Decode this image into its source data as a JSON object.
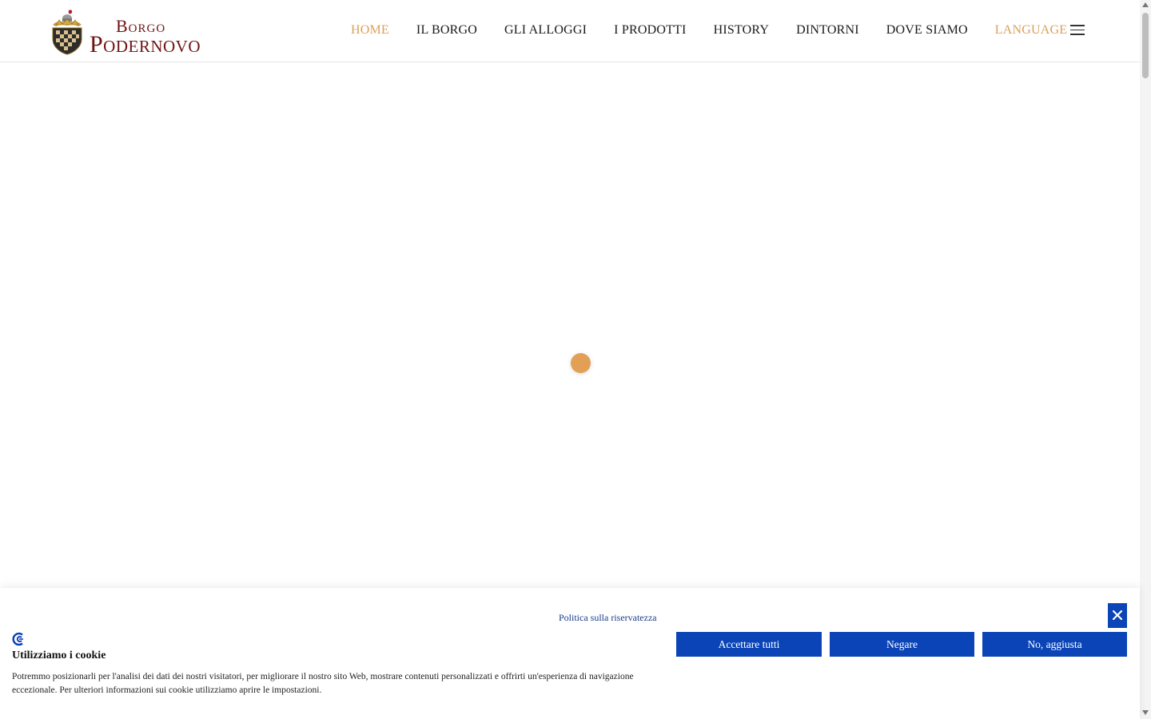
{
  "header": {
    "logo_line1": "Borgo",
    "logo_line2": "Podernovo",
    "nav": [
      {
        "label": "HOME"
      },
      {
        "label": "IL BORGO"
      },
      {
        "label": "GLI ALLOGGI"
      },
      {
        "label": "I PRODOTTI"
      },
      {
        "label": "HISTORY"
      },
      {
        "label": "DINTORNI"
      },
      {
        "label": "DOVE SIAMO"
      },
      {
        "label": "LANGUAGE"
      }
    ]
  },
  "cookie": {
    "privacy_link": "Politica sulla riservatezza",
    "title": "Utilizziamo i cookie",
    "text": "Potremmo posizionarli per l'analisi dei dati dei nostri visitatori, per migliorare il nostro sito Web, mostrare contenuti personalizzati e offrirti un'esperienza di navigazione eccezionale. Per ulteriori informazioni sui cookie utilizziamo aprire le impostazioni.",
    "accept_label": "Accettare tutti",
    "deny_label": "Negare",
    "adjust_label": "No, aggiusta"
  },
  "colors": {
    "accent": "#d9a05b",
    "brand": "#6e1414",
    "button": "#0b44b6"
  },
  "icons": {
    "menu": "hamburger-icon",
    "close": "close-icon",
    "cookie_brand": "cookie-consent-logo-icon",
    "loader": "loading-dot-icon"
  }
}
